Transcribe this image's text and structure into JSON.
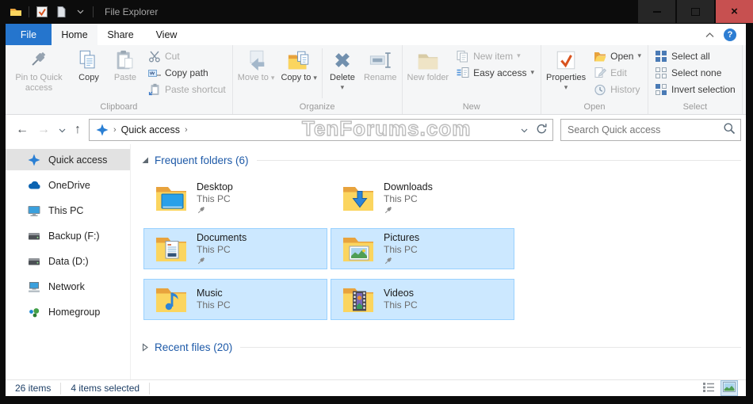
{
  "titlebar": {
    "title": "File Explorer"
  },
  "tabs": [
    {
      "label": "File"
    },
    {
      "label": "Home"
    },
    {
      "label": "Share"
    },
    {
      "label": "View"
    }
  ],
  "ribbon": {
    "groups": [
      {
        "name": "Clipboard",
        "big": [
          {
            "label": "Pin to Quick access",
            "icon": "pin",
            "enabled": false
          },
          {
            "label": "Copy",
            "icon": "copy",
            "enabled": true
          },
          {
            "label": "Paste",
            "icon": "paste",
            "enabled": false
          }
        ],
        "small": [
          {
            "label": "Cut",
            "icon": "scissors",
            "enabled": false
          },
          {
            "label": "Copy path",
            "icon": "copy-path",
            "enabled": true
          },
          {
            "label": "Paste shortcut",
            "icon": "paste-shortcut",
            "enabled": false
          }
        ]
      },
      {
        "name": "Organize",
        "big": [
          {
            "label": "Move to",
            "icon": "move-to",
            "enabled": false,
            "arrow": "inline"
          },
          {
            "label": "Copy to",
            "icon": "copy-to",
            "enabled": true,
            "arrow": "inline"
          },
          {
            "divider": true
          },
          {
            "label": "Delete",
            "icon": "delete",
            "enabled": true,
            "arrow": "below"
          },
          {
            "label": "Rename",
            "icon": "rename",
            "enabled": false
          }
        ]
      },
      {
        "name": "New",
        "big": [
          {
            "label": "New folder",
            "icon": "new-folder",
            "enabled": false
          }
        ],
        "small": [
          {
            "label": "New item",
            "icon": "new-item",
            "enabled": false,
            "arrow": "inline"
          },
          {
            "label": "Easy access",
            "icon": "easy-access",
            "enabled": true,
            "arrow": "inline"
          }
        ]
      },
      {
        "name": "Open",
        "big": [
          {
            "label": "Properties",
            "icon": "properties",
            "enabled": true,
            "arrow": "below"
          }
        ],
        "small": [
          {
            "label": "Open",
            "icon": "open-folder",
            "enabled": true,
            "arrow": "inline"
          },
          {
            "label": "Edit",
            "icon": "edit",
            "enabled": false
          },
          {
            "label": "History",
            "icon": "history",
            "enabled": false
          }
        ]
      },
      {
        "name": "Select",
        "small": [
          {
            "label": "Select all",
            "icon": "select-all",
            "enabled": true
          },
          {
            "label": "Select none",
            "icon": "select-none",
            "enabled": true
          },
          {
            "label": "Invert selection",
            "icon": "invert-selection",
            "enabled": true
          }
        ]
      }
    ]
  },
  "navigation": {
    "breadcrumb_root": "Quick access",
    "search_placeholder": "Search Quick access"
  },
  "watermark": "TenForums.com",
  "sidebar": {
    "items": [
      {
        "label": "Quick access",
        "icon": "quick-access",
        "selected": true
      },
      {
        "label": "OneDrive",
        "icon": "onedrive",
        "selected": false
      },
      {
        "label": "This PC",
        "icon": "this-pc",
        "selected": false
      },
      {
        "label": "Backup (F:)",
        "icon": "drive",
        "selected": false
      },
      {
        "label": "Data (D:)",
        "icon": "drive",
        "selected": false
      },
      {
        "label": "Network",
        "icon": "network",
        "selected": false
      },
      {
        "label": "Homegroup",
        "icon": "homegroup",
        "selected": false
      }
    ]
  },
  "main": {
    "sections": [
      {
        "label": "Frequent folders (6)",
        "expanded": true
      },
      {
        "label": "Recent files (20)",
        "expanded": false
      }
    ],
    "folders": [
      {
        "name": "Desktop",
        "location": "This PC",
        "pinned": true,
        "selected": false,
        "icon": "folder-desktop"
      },
      {
        "name": "Downloads",
        "location": "This PC",
        "pinned": true,
        "selected": false,
        "icon": "folder-downloads"
      },
      {
        "name": "Documents",
        "location": "This PC",
        "pinned": true,
        "selected": true,
        "icon": "folder-documents"
      },
      {
        "name": "Pictures",
        "location": "This PC",
        "pinned": true,
        "selected": true,
        "icon": "folder-pictures"
      },
      {
        "name": "Music",
        "location": "This PC",
        "pinned": false,
        "selected": true,
        "icon": "folder-music"
      },
      {
        "name": "Videos",
        "location": "This PC",
        "pinned": false,
        "selected": true,
        "icon": "folder-videos"
      }
    ]
  },
  "statusbar": {
    "total": "26 items",
    "selected": "4 items selected"
  },
  "colors": {
    "accent_blue": "#2575cd",
    "selection_bg": "#cce8ff",
    "selection_border": "#99d1ff",
    "close_button": "#c75050",
    "header_blue": "#1e5aa8"
  }
}
